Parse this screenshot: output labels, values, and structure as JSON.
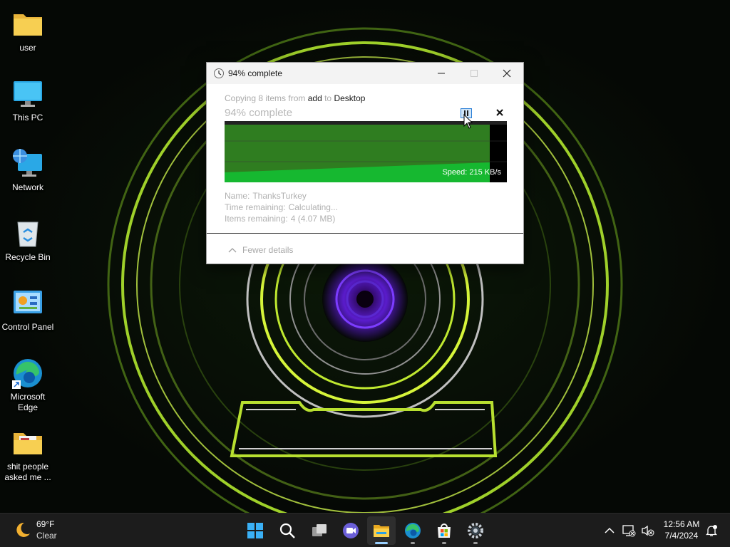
{
  "desktop": {
    "icons": [
      {
        "label": "user",
        "icon": "folder-icon"
      },
      {
        "label": "This PC",
        "icon": "monitor-icon"
      },
      {
        "label": "Network",
        "icon": "network-icon"
      },
      {
        "label": "Recycle Bin",
        "icon": "recycle-bin-icon"
      },
      {
        "label": "Control Panel",
        "icon": "control-panel-icon"
      },
      {
        "label": "Microsoft Edge",
        "icon": "edge-icon"
      },
      {
        "label": "shit people asked me ...",
        "icon": "folder-icon"
      }
    ]
  },
  "dialog": {
    "title": "94% complete",
    "copy_prefix": "Copying 8 items from",
    "copy_source": "add",
    "copy_to": "to",
    "copy_dest": "Desktop",
    "percent_text": "94% complete",
    "progress": 0.94,
    "speed_text": "Speed: 215 KB/s",
    "name_label": "Name:",
    "name_value": "ThanksTurkey",
    "time_label": "Time remaining:",
    "time_value": "Calculating...",
    "items_label": "Items remaining:",
    "items_value": "4 (4.07 MB)",
    "fewer_details": "Fewer details",
    "colors": {
      "graph_fill": "#2f7d20",
      "graph_line": "#16b830"
    }
  },
  "taskbar": {
    "weather_temp": "69°F",
    "weather_condition": "Clear",
    "apps": [
      "start-icon",
      "search-icon",
      "task-view-icon",
      "meet-icon",
      "file-explorer-icon",
      "edge-icon",
      "store-icon",
      "settings-icon"
    ],
    "active_app": "file-explorer-icon",
    "clock_time": "12:56 AM",
    "clock_date": "7/4/2024"
  }
}
